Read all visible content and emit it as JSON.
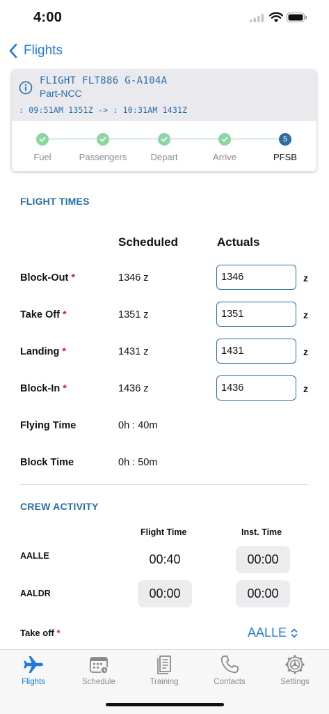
{
  "status_bar": {
    "time": "4:00"
  },
  "nav": {
    "back_label": "Flights"
  },
  "flight_card": {
    "title": "FLIGHT FLT886 G-A104A",
    "type": "Part-NCC",
    "times": ": 09:51AM 1351Z -> : 10:31AM 1431Z",
    "steps": [
      {
        "label": "Fuel",
        "state": "done"
      },
      {
        "label": "Passengers",
        "state": "done"
      },
      {
        "label": "Depart",
        "state": "done"
      },
      {
        "label": "Arrive",
        "state": "done"
      },
      {
        "label": "PFSB",
        "state": "current",
        "number": "5"
      }
    ]
  },
  "flight_times": {
    "section_title": "FLIGHT TIMES",
    "col_scheduled": "Scheduled",
    "col_actuals": "Actuals",
    "rows": [
      {
        "label": "Block-Out",
        "required": "*",
        "scheduled": "1346 z",
        "actual": "1346",
        "unit": "z"
      },
      {
        "label": "Take Off",
        "required": "*",
        "scheduled": "1351 z",
        "actual": "1351",
        "unit": "z"
      },
      {
        "label": "Landing",
        "required": "*",
        "scheduled": "1431 z",
        "actual": "1431",
        "unit": "z"
      },
      {
        "label": "Block-In",
        "required": "*",
        "scheduled": "1436 z",
        "actual": "1436",
        "unit": "z"
      }
    ],
    "flying_time": {
      "label": "Flying Time",
      "value": "0h : 40m"
    },
    "block_time": {
      "label": "Block Time",
      "value": "0h : 50m"
    }
  },
  "crew_activity": {
    "section_title": "CREW ACTIVITY",
    "col_flight_time": "Flight Time",
    "col_inst_time": "Inst. Time",
    "crew": [
      {
        "name": "AALLE",
        "flight_time": "00:40",
        "inst_time": "00:00"
      },
      {
        "name": "AALDR",
        "flight_time": "00:00",
        "inst_time": "00:00"
      }
    ],
    "takeoff_label": "Take off",
    "takeoff_required": "*",
    "takeoff_value": "AALLE"
  },
  "tab_bar": {
    "tabs": [
      {
        "label": "Flights",
        "icon": "airplane-icon",
        "active": true
      },
      {
        "label": "Schedule",
        "icon": "calendar-icon",
        "active": false
      },
      {
        "label": "Training",
        "icon": "book-icon",
        "active": false
      },
      {
        "label": "Contacts",
        "icon": "phone-icon",
        "active": false
      },
      {
        "label": "Settings",
        "icon": "gear-icon",
        "active": false
      }
    ]
  },
  "colors": {
    "accent": "#1f7ae0",
    "section": "#2a6ea6",
    "step_done": "#8ed5a4",
    "step_current": "#2d6ea0",
    "required": "#e02020"
  }
}
